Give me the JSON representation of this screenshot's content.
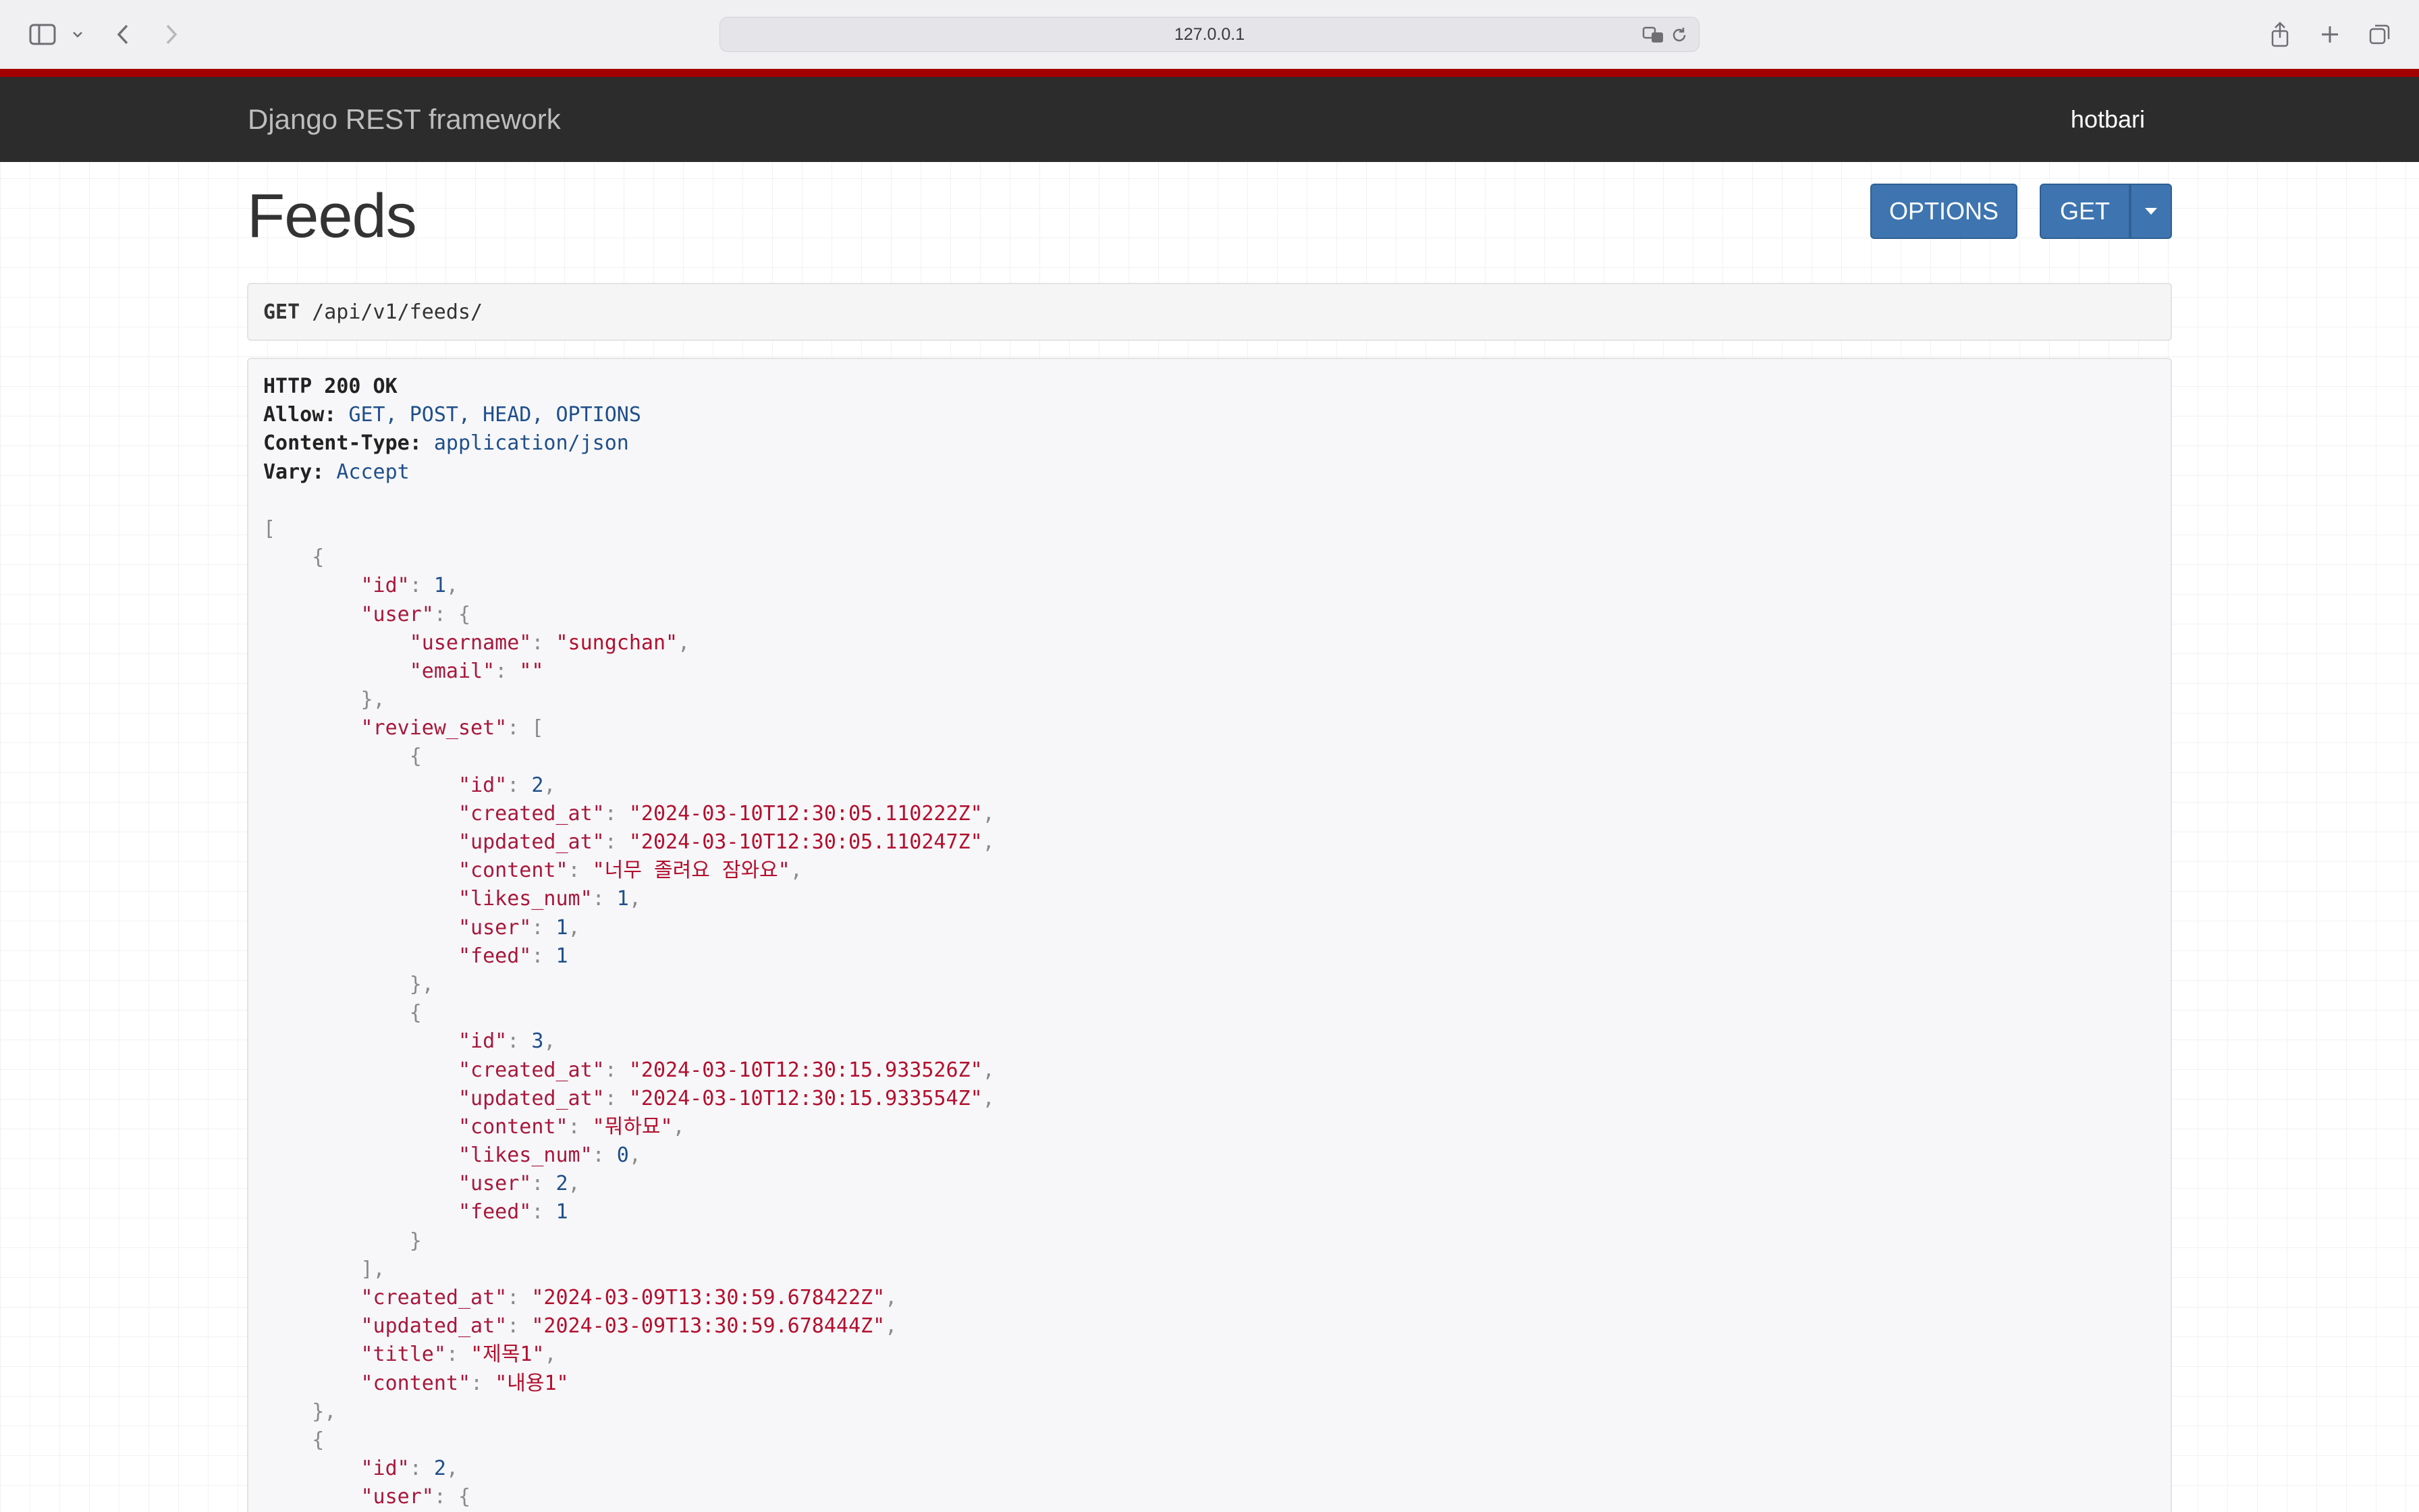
{
  "browser": {
    "url": "127.0.0.1",
    "icons": [
      "sidebar-icon",
      "chevron-down-icon",
      "back-icon",
      "forward-icon",
      "translate-icon",
      "reload-icon",
      "share-icon",
      "new-tab-icon",
      "tabs-overview-icon"
    ]
  },
  "navbar": {
    "brand": "Django REST framework",
    "user": "hotbari"
  },
  "page": {
    "title": "Feeds",
    "options_button": "OPTIONS",
    "get_button": "GET"
  },
  "request": {
    "method": "GET",
    "path": "/api/v1/feeds/"
  },
  "response": {
    "status": "HTTP 200 OK",
    "headers": [
      {
        "key": "Allow:",
        "value": "GET, POST, HEAD, OPTIONS"
      },
      {
        "key": "Content-Type:",
        "value": "application/json"
      },
      {
        "key": "Vary:",
        "value": "Accept"
      }
    ],
    "body_lines": [
      [
        {
          "t": "[",
          "c": "pun"
        }
      ],
      [
        {
          "t": "    {",
          "c": "pun"
        }
      ],
      [
        {
          "t": "        ",
          "c": "pun"
        },
        {
          "t": "\"id\"",
          "c": "key"
        },
        {
          "t": ": ",
          "c": "pun"
        },
        {
          "t": "1",
          "c": "num"
        },
        {
          "t": ",",
          "c": "pun"
        }
      ],
      [
        {
          "t": "        ",
          "c": "pun"
        },
        {
          "t": "\"user\"",
          "c": "key"
        },
        {
          "t": ": {",
          "c": "pun"
        }
      ],
      [
        {
          "t": "            ",
          "c": "pun"
        },
        {
          "t": "\"username\"",
          "c": "key"
        },
        {
          "t": ": ",
          "c": "pun"
        },
        {
          "t": "\"sungchan\"",
          "c": "str"
        },
        {
          "t": ",",
          "c": "pun"
        }
      ],
      [
        {
          "t": "            ",
          "c": "pun"
        },
        {
          "t": "\"email\"",
          "c": "key"
        },
        {
          "t": ": ",
          "c": "pun"
        },
        {
          "t": "\"\"",
          "c": "str"
        }
      ],
      [
        {
          "t": "        },",
          "c": "pun"
        }
      ],
      [
        {
          "t": "        ",
          "c": "pun"
        },
        {
          "t": "\"review_set\"",
          "c": "key"
        },
        {
          "t": ": [",
          "c": "pun"
        }
      ],
      [
        {
          "t": "            {",
          "c": "pun"
        }
      ],
      [
        {
          "t": "                ",
          "c": "pun"
        },
        {
          "t": "\"id\"",
          "c": "key"
        },
        {
          "t": ": ",
          "c": "pun"
        },
        {
          "t": "2",
          "c": "num"
        },
        {
          "t": ",",
          "c": "pun"
        }
      ],
      [
        {
          "t": "                ",
          "c": "pun"
        },
        {
          "t": "\"created_at\"",
          "c": "key"
        },
        {
          "t": ": ",
          "c": "pun"
        },
        {
          "t": "\"2024-03-10T12:30:05.110222Z\"",
          "c": "str"
        },
        {
          "t": ",",
          "c": "pun"
        }
      ],
      [
        {
          "t": "                ",
          "c": "pun"
        },
        {
          "t": "\"updated_at\"",
          "c": "key"
        },
        {
          "t": ": ",
          "c": "pun"
        },
        {
          "t": "\"2024-03-10T12:30:05.110247Z\"",
          "c": "str"
        },
        {
          "t": ",",
          "c": "pun"
        }
      ],
      [
        {
          "t": "                ",
          "c": "pun"
        },
        {
          "t": "\"content\"",
          "c": "key"
        },
        {
          "t": ": ",
          "c": "pun"
        },
        {
          "t": "\"너무 졸려요 잠와요\"",
          "c": "str"
        },
        {
          "t": ",",
          "c": "pun"
        }
      ],
      [
        {
          "t": "                ",
          "c": "pun"
        },
        {
          "t": "\"likes_num\"",
          "c": "key"
        },
        {
          "t": ": ",
          "c": "pun"
        },
        {
          "t": "1",
          "c": "num"
        },
        {
          "t": ",",
          "c": "pun"
        }
      ],
      [
        {
          "t": "                ",
          "c": "pun"
        },
        {
          "t": "\"user\"",
          "c": "key"
        },
        {
          "t": ": ",
          "c": "pun"
        },
        {
          "t": "1",
          "c": "num"
        },
        {
          "t": ",",
          "c": "pun"
        }
      ],
      [
        {
          "t": "                ",
          "c": "pun"
        },
        {
          "t": "\"feed\"",
          "c": "key"
        },
        {
          "t": ": ",
          "c": "pun"
        },
        {
          "t": "1",
          "c": "num"
        }
      ],
      [
        {
          "t": "            },",
          "c": "pun"
        }
      ],
      [
        {
          "t": "            {",
          "c": "pun"
        }
      ],
      [
        {
          "t": "                ",
          "c": "pun"
        },
        {
          "t": "\"id\"",
          "c": "key"
        },
        {
          "t": ": ",
          "c": "pun"
        },
        {
          "t": "3",
          "c": "num"
        },
        {
          "t": ",",
          "c": "pun"
        }
      ],
      [
        {
          "t": "                ",
          "c": "pun"
        },
        {
          "t": "\"created_at\"",
          "c": "key"
        },
        {
          "t": ": ",
          "c": "pun"
        },
        {
          "t": "\"2024-03-10T12:30:15.933526Z\"",
          "c": "str"
        },
        {
          "t": ",",
          "c": "pun"
        }
      ],
      [
        {
          "t": "                ",
          "c": "pun"
        },
        {
          "t": "\"updated_at\"",
          "c": "key"
        },
        {
          "t": ": ",
          "c": "pun"
        },
        {
          "t": "\"2024-03-10T12:30:15.933554Z\"",
          "c": "str"
        },
        {
          "t": ",",
          "c": "pun"
        }
      ],
      [
        {
          "t": "                ",
          "c": "pun"
        },
        {
          "t": "\"content\"",
          "c": "key"
        },
        {
          "t": ": ",
          "c": "pun"
        },
        {
          "t": "\"뭐하묘\"",
          "c": "str"
        },
        {
          "t": ",",
          "c": "pun"
        }
      ],
      [
        {
          "t": "                ",
          "c": "pun"
        },
        {
          "t": "\"likes_num\"",
          "c": "key"
        },
        {
          "t": ": ",
          "c": "pun"
        },
        {
          "t": "0",
          "c": "num"
        },
        {
          "t": ",",
          "c": "pun"
        }
      ],
      [
        {
          "t": "                ",
          "c": "pun"
        },
        {
          "t": "\"user\"",
          "c": "key"
        },
        {
          "t": ": ",
          "c": "pun"
        },
        {
          "t": "2",
          "c": "num"
        },
        {
          "t": ",",
          "c": "pun"
        }
      ],
      [
        {
          "t": "                ",
          "c": "pun"
        },
        {
          "t": "\"feed\"",
          "c": "key"
        },
        {
          "t": ": ",
          "c": "pun"
        },
        {
          "t": "1",
          "c": "num"
        }
      ],
      [
        {
          "t": "            }",
          "c": "pun"
        }
      ],
      [
        {
          "t": "        ],",
          "c": "pun"
        }
      ],
      [
        {
          "t": "        ",
          "c": "pun"
        },
        {
          "t": "\"created_at\"",
          "c": "key"
        },
        {
          "t": ": ",
          "c": "pun"
        },
        {
          "t": "\"2024-03-09T13:30:59.678422Z\"",
          "c": "str"
        },
        {
          "t": ",",
          "c": "pun"
        }
      ],
      [
        {
          "t": "        ",
          "c": "pun"
        },
        {
          "t": "\"updated_at\"",
          "c": "key"
        },
        {
          "t": ": ",
          "c": "pun"
        },
        {
          "t": "\"2024-03-09T13:30:59.678444Z\"",
          "c": "str"
        },
        {
          "t": ",",
          "c": "pun"
        }
      ],
      [
        {
          "t": "        ",
          "c": "pun"
        },
        {
          "t": "\"title\"",
          "c": "key"
        },
        {
          "t": ": ",
          "c": "pun"
        },
        {
          "t": "\"제목1\"",
          "c": "str"
        },
        {
          "t": ",",
          "c": "pun"
        }
      ],
      [
        {
          "t": "        ",
          "c": "pun"
        },
        {
          "t": "\"content\"",
          "c": "key"
        },
        {
          "t": ": ",
          "c": "pun"
        },
        {
          "t": "\"내용1\"",
          "c": "str"
        }
      ],
      [
        {
          "t": "    },",
          "c": "pun"
        }
      ],
      [
        {
          "t": "    {",
          "c": "pun"
        }
      ],
      [
        {
          "t": "        ",
          "c": "pun"
        },
        {
          "t": "\"id\"",
          "c": "key"
        },
        {
          "t": ": ",
          "c": "pun"
        },
        {
          "t": "2",
          "c": "num"
        },
        {
          "t": ",",
          "c": "pun"
        }
      ],
      [
        {
          "t": "        ",
          "c": "pun"
        },
        {
          "t": "\"user\"",
          "c": "key"
        },
        {
          "t": ": {",
          "c": "pun"
        }
      ]
    ]
  },
  "colors": {
    "navbar_bg": "#2c2c2c",
    "accent_bar": "#a30000",
    "button_primary": "#3e75b0",
    "json_key": "#a8183c",
    "json_number": "#1f4f8a"
  }
}
